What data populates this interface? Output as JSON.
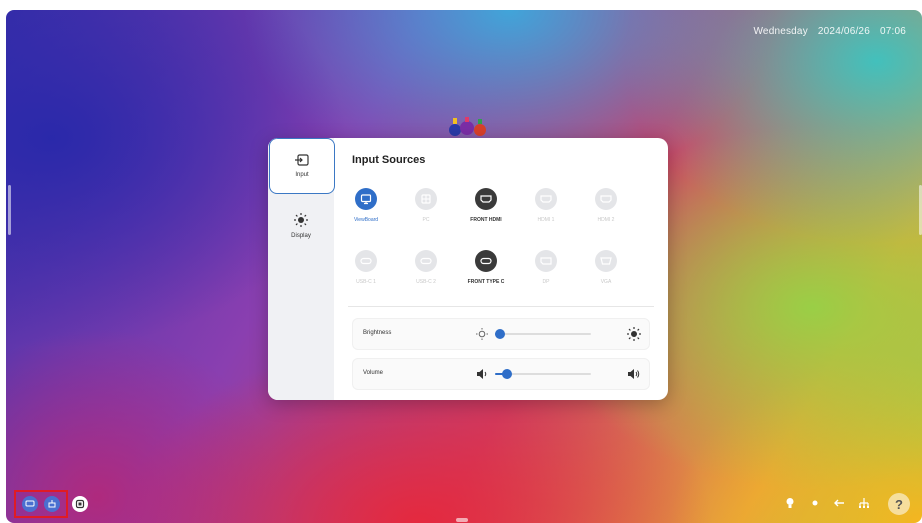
{
  "status_bar": {
    "day": "Wednesday",
    "date": "2024/06/26",
    "time": "07:06"
  },
  "panel": {
    "nav": [
      {
        "label": "Input",
        "icon": "input-icon",
        "active": true
      },
      {
        "label": "Display",
        "icon": "brightness-icon",
        "active": false
      }
    ],
    "title": "Input Sources",
    "sources": [
      {
        "label": "ViewBoard",
        "state": "selected",
        "icon": "viewboard-icon"
      },
      {
        "label": "PC",
        "state": "disabled",
        "icon": "pc-icon"
      },
      {
        "label": "FRONT HDMI",
        "state": "available",
        "icon": "hdmi-icon"
      },
      {
        "label": "HDMI 1",
        "state": "disabled",
        "icon": "hdmi-icon"
      },
      {
        "label": "HDMI 2",
        "state": "disabled",
        "icon": "hdmi-icon"
      },
      {
        "label": "USB-C 1",
        "state": "disabled",
        "icon": "usb-c-icon"
      },
      {
        "label": "USB-C 2",
        "state": "disabled",
        "icon": "usb-c-icon"
      },
      {
        "label": "FRONT TYPE C",
        "state": "available",
        "icon": "usb-c-icon"
      },
      {
        "label": "DP",
        "state": "disabled",
        "icon": "displayport-icon"
      },
      {
        "label": "VGA",
        "state": "disabled",
        "icon": "vga-icon"
      }
    ],
    "sliders": {
      "brightness": {
        "label": "Brightness",
        "value": 0.05
      },
      "volume": {
        "label": "Volume",
        "value": 0.12
      }
    }
  },
  "taskbar": {
    "left_icons": [
      "source-icon",
      "toolbox-icon",
      "screen-share-icon"
    ],
    "tray_icons": [
      "lightbulb-icon",
      "dot-icon",
      "back-arrow-icon",
      "network-icon"
    ],
    "help_label": "?"
  },
  "colors": {
    "accent": "#2f6ec8",
    "highlight_box": "#e01b24"
  }
}
